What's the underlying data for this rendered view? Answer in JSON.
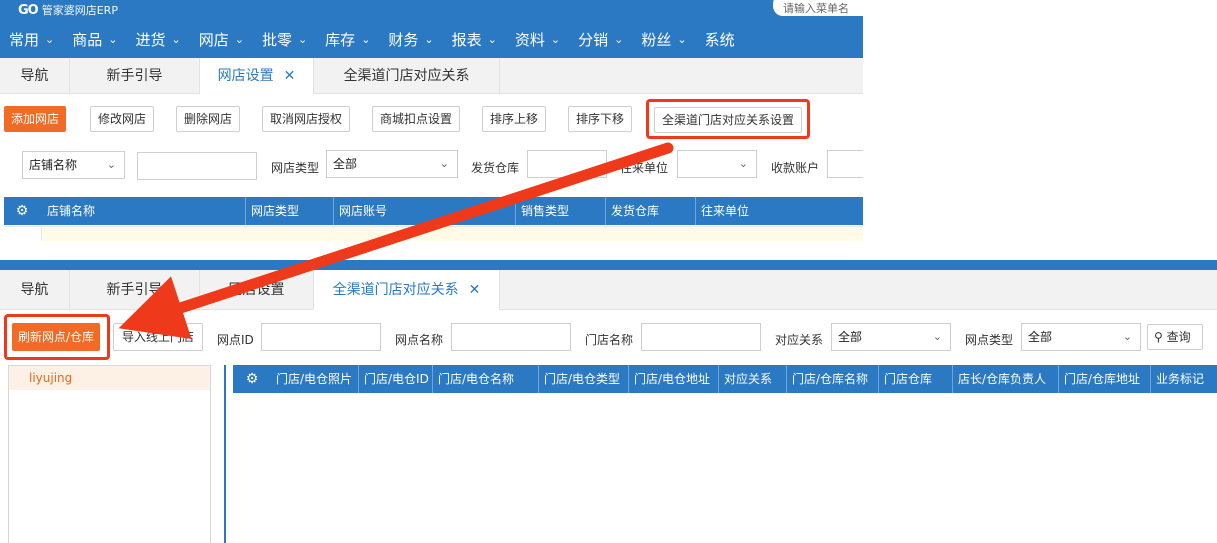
{
  "top": {
    "brand": {
      "mark": "GO",
      "text": "管家婆网店ERP"
    },
    "search_placeholder": "请输入菜单名",
    "menu": [
      "常用",
      "商品",
      "进货",
      "网店",
      "批零",
      "库存",
      "财务",
      "报表",
      "资料",
      "分销",
      "粉丝",
      "系统"
    ],
    "tabs": [
      {
        "label": "导航",
        "active": false,
        "closable": false
      },
      {
        "label": "新手引导",
        "active": false,
        "closable": false
      },
      {
        "label": "网店设置",
        "active": true,
        "closable": true
      },
      {
        "label": "全渠道门店对应关系",
        "active": false,
        "closable": false
      }
    ],
    "toolbar": [
      "添加网店",
      "修改网店",
      "删除网店",
      "取消网店授权",
      "商城扣点设置",
      "排序上移",
      "排序下移",
      "全渠道门店对应关系设置"
    ],
    "filters": {
      "store_name_select": "店铺名称",
      "store_type_label": "网店类型",
      "store_type_value": "全部",
      "warehouse_label": "发货仓库",
      "partner_label": "往来单位",
      "account_label": "收款账户"
    },
    "table_headers": [
      "店铺名称",
      "网店类型",
      "网店账号",
      "销售类型",
      "发货仓库",
      "往来单位"
    ]
  },
  "bottom": {
    "tabs": [
      {
        "label": "导航",
        "active": false,
        "closable": false
      },
      {
        "label": "新手引导",
        "active": false,
        "closable": false
      },
      {
        "label": "网店设置",
        "active": false,
        "closable": false
      },
      {
        "label": "全渠道门店对应关系",
        "active": true,
        "closable": true
      }
    ],
    "buttons": {
      "refresh": "刷新网点/仓库",
      "import": "导入线上门店",
      "search": "查询"
    },
    "filters": {
      "point_id_label": "网点ID",
      "point_name_label": "网点名称",
      "store_name_label": "门店名称",
      "relation_label": "对应关系",
      "relation_value": "全部",
      "point_type_label": "网点类型",
      "point_type_value": "全部"
    },
    "tree_items": [
      "liyujing"
    ],
    "table_headers": [
      "门店/电仓照片",
      "门店/电仓ID",
      "门店/电仓名称",
      "门店/电仓类型",
      "门店/电仓地址",
      "对应关系",
      "门店/仓库名称",
      "门店仓库",
      "店长/仓库负责人",
      "门店/仓库地址",
      "业务标记"
    ]
  },
  "colors": {
    "brand_blue": "#2b79c2",
    "accent_orange": "#f26b26",
    "highlight_red": "#ee3a1a"
  },
  "icons": {
    "close": "close-icon",
    "chevron": "chevron-down-icon",
    "gear": "gear-icon",
    "search": "search-icon"
  }
}
